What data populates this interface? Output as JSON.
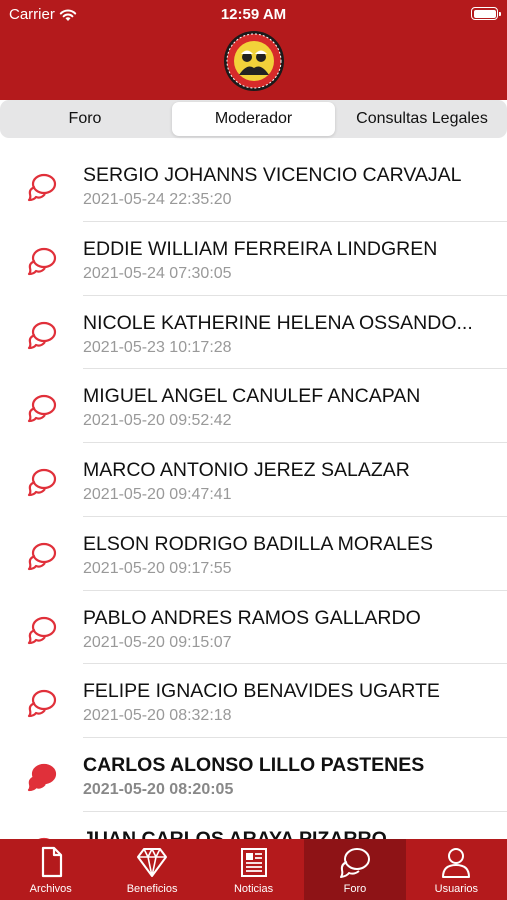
{
  "status_bar": {
    "carrier": "Carrier",
    "time": "12:59 AM"
  },
  "segments": [
    {
      "label": "Foro"
    },
    {
      "label": "Moderador",
      "selected": true
    },
    {
      "label": "Consultas Legales"
    }
  ],
  "threads": [
    {
      "name": "SERGIO JOHANNS VICENCIO CARVAJAL",
      "date": "2021-05-24 22:35:20",
      "unread": false
    },
    {
      "name": "EDDIE WILLIAM FERREIRA LINDGREN",
      "date": "2021-05-24 07:30:05",
      "unread": false
    },
    {
      "name": "NICOLE KATHERINE HELENA OSSANDO...",
      "date": "2021-05-23 10:17:28",
      "unread": false
    },
    {
      "name": "MIGUEL ANGEL CANULEF ANCAPAN",
      "date": "2021-05-20 09:52:42",
      "unread": false
    },
    {
      "name": "MARCO ANTONIO JEREZ SALAZAR",
      "date": "2021-05-20 09:47:41",
      "unread": false
    },
    {
      "name": "ELSON RODRIGO BADILLA MORALES",
      "date": "2021-05-20 09:17:55",
      "unread": false
    },
    {
      "name": "PABLO ANDRES RAMOS GALLARDO",
      "date": "2021-05-20 09:15:07",
      "unread": false
    },
    {
      "name": "FELIPE IGNACIO BENAVIDES UGARTE",
      "date": "2021-05-20 08:32:18",
      "unread": false
    },
    {
      "name": "CARLOS ALONSO LILLO PASTENES",
      "date": "2021-05-20 08:20:05",
      "unread": true
    },
    {
      "name": "JUAN CARLOS ARAYA PIZARRO",
      "date": "",
      "unread": true
    }
  ],
  "tabs": [
    {
      "label": "Archivos",
      "icon": "document-icon"
    },
    {
      "label": "Beneficios",
      "icon": "diamond-icon"
    },
    {
      "label": "Noticias",
      "icon": "newspaper-icon"
    },
    {
      "label": "Foro",
      "icon": "chat-bubbles-icon",
      "active": true
    },
    {
      "label": "Usuarios",
      "icon": "user-icon"
    }
  ],
  "colors": {
    "brand_red": "#b41a1c",
    "active_tab": "#8e1316",
    "icon_red": "#e0303a"
  }
}
